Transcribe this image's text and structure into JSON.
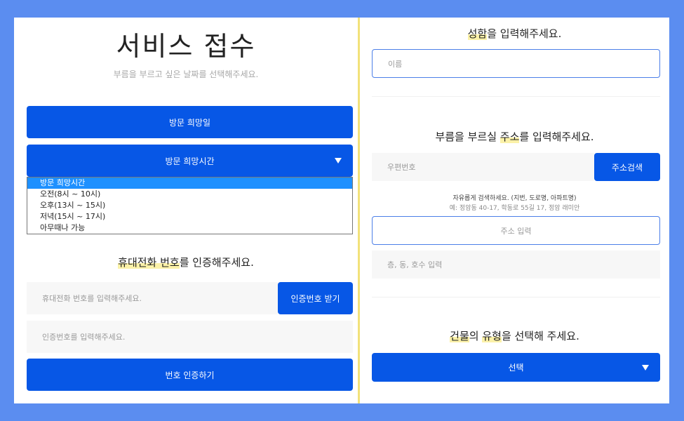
{
  "left": {
    "title": "서비스 접수",
    "subtitle": "부름을 부르고 싶은 날짜를 선택해주세요.",
    "visit_date_button": "방문 희망일",
    "visit_time_select": "방문 희망시간",
    "time_options": [
      "방문 희망시간",
      "오전(8시 ~ 10시)",
      "오후(13시 ~ 15시)",
      "저녁(15시 ~ 17시)",
      "아무때나 가능"
    ],
    "phone_heading_pre": "",
    "phone_heading_hl1": "휴대전화 번호",
    "phone_heading_rest": "를 인증해주세요.",
    "phone_placeholder": "휴대전화 번호를 입력해주세요.",
    "get_code_button": "인증번호 받기",
    "code_placeholder": "인증번호를 입력해주세요.",
    "verify_button": "번호 인증하기"
  },
  "right": {
    "name_heading_hl": "성함",
    "name_heading_rest": "을 입력해주세요.",
    "name_placeholder": "이름",
    "address_heading_pre": "부름을 부르실 ",
    "address_heading_hl": "주소",
    "address_heading_rest": "를 입력해주세요.",
    "zipcode_placeholder": "우편번호",
    "address_search_button": "주소검색",
    "address_note": "자유롭게 검색하세요. (지번, 도로명, 아파트명)",
    "address_example": "예: 정암동 40-17, 학동로 55길 17, 정암 래미안",
    "address_input_placeholder": "주소 입력",
    "detail_placeholder": "층, 동, 호수 입력",
    "building_heading_hl1": "건물",
    "building_heading_mid": "의 ",
    "building_heading_hl2": "유형",
    "building_heading_rest": "을 선택해 주세요.",
    "building_select": "선택"
  },
  "colors": {
    "background": "#5b8df0",
    "accent": "#0757e6",
    "highlight": "#fbf1a8",
    "divider": "#f2e27a"
  }
}
